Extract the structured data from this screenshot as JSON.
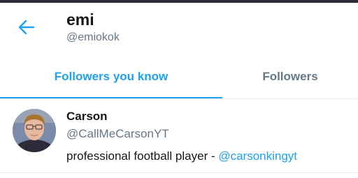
{
  "header": {
    "name": "emi",
    "handle": "@emiokok",
    "back_icon": "arrow-left-icon"
  },
  "tabs": [
    {
      "label": "Followers you know",
      "active": true
    },
    {
      "label": "Followers",
      "active": false
    }
  ],
  "users": [
    {
      "name": "Carson",
      "handle": "@CallMeCarsonYT",
      "bio_text": "professional football player - ",
      "bio_link": "@carsonkingyt"
    }
  ],
  "colors": {
    "accent": "#1da1f2",
    "secondary_text": "#657786",
    "primary_text": "#14171a",
    "divider": "#e6ecf0"
  }
}
